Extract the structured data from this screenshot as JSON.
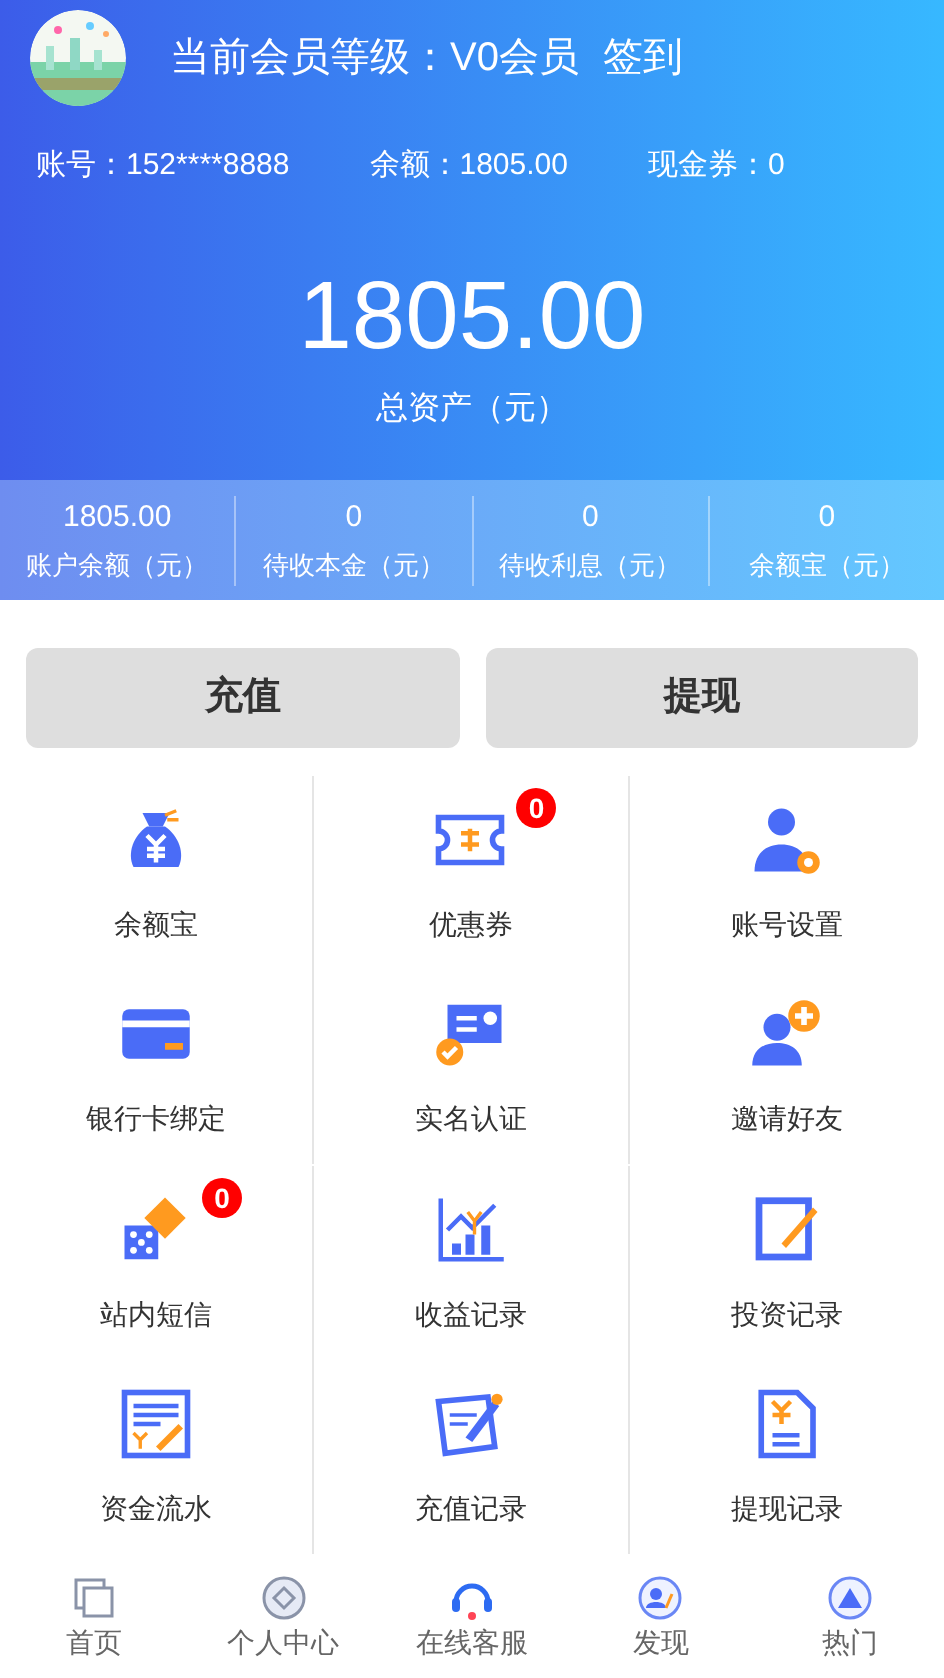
{
  "header": {
    "level_label": "当前会员等级：V0会员",
    "checkin": "签到"
  },
  "info": [
    {
      "label": "账号：",
      "value": "152****8888"
    },
    {
      "label": "余额：",
      "value": "1805.00"
    },
    {
      "label": "现金券：",
      "value": "0"
    }
  ],
  "total": {
    "amount": "1805.00",
    "label": "总资产（元）"
  },
  "stats": [
    {
      "value": "1805.00",
      "label": "账户余额（元）"
    },
    {
      "value": "0",
      "label": "待收本金（元）"
    },
    {
      "value": "0",
      "label": "待收利息（元）"
    },
    {
      "value": "0",
      "label": "余额宝（元）"
    }
  ],
  "actions": [
    "充值",
    "提现"
  ],
  "menu": [
    {
      "label": "余额宝"
    },
    {
      "label": "优惠券",
      "badge": "0"
    },
    {
      "label": "账号设置"
    },
    {
      "label": "银行卡绑定"
    },
    {
      "label": "实名认证"
    },
    {
      "label": "邀请好友"
    },
    {
      "label": "站内短信",
      "badge": "0"
    },
    {
      "label": "收益记录"
    },
    {
      "label": "投资记录"
    },
    {
      "label": "资金流水"
    },
    {
      "label": "充值记录"
    },
    {
      "label": "提现记录"
    }
  ],
  "tabbar": [
    "首页",
    "个人中心",
    "在线客服",
    "发现",
    "热门"
  ]
}
